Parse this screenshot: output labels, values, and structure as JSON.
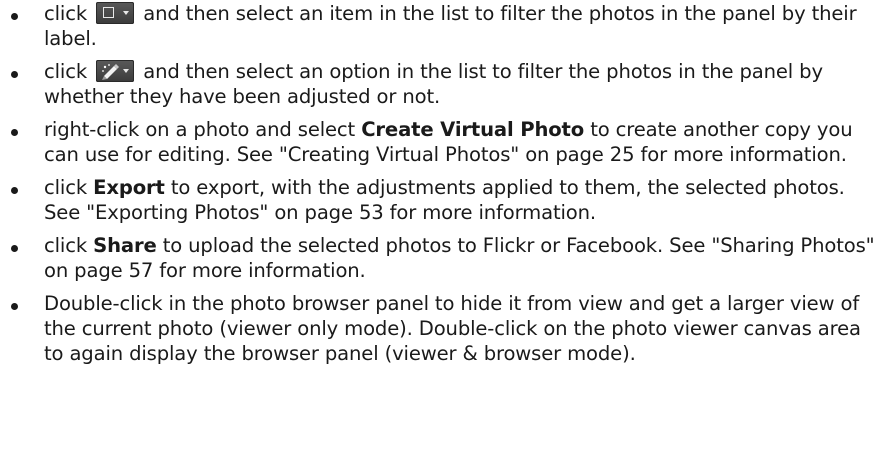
{
  "icons": {
    "label_filter": "label-filter-icon",
    "adjusted_filter": "pencil-filter-icon",
    "dropdown": "chevron-down-icon"
  },
  "items": [
    {
      "text_a": "click",
      "text_b": "and then select an item in the list to filter the photos in the panel by their label."
    },
    {
      "text_a": "click",
      "text_b": "and then select an option in the list to filter the photos in the panel by whether they have been adjusted or not."
    },
    {
      "text_a": "right-click on a photo and select",
      "bold": "Create Virtual Photo",
      "text_b": "to create another copy you can use for editing. See \"Creating Virtual Photos\" on page 25 for more information."
    },
    {
      "text_a": "click",
      "bold": "Export",
      "text_b": "to export, with the adjustments applied to them, the selected photos. See \"Exporting Photos\" on page 53 for more information."
    },
    {
      "text_a": "click",
      "bold": "Share",
      "text_b": "to upload the selected photos to Flickr or Facebook. See \"Sharing Photos\" on page 57 for more information."
    },
    {
      "text_a": "Double-click in the photo browser panel to hide it from view and get a larger view of the current photo (viewer only mode). Double-click on the photo viewer canvas area to again display the browser panel (viewer & browser mode)."
    }
  ]
}
